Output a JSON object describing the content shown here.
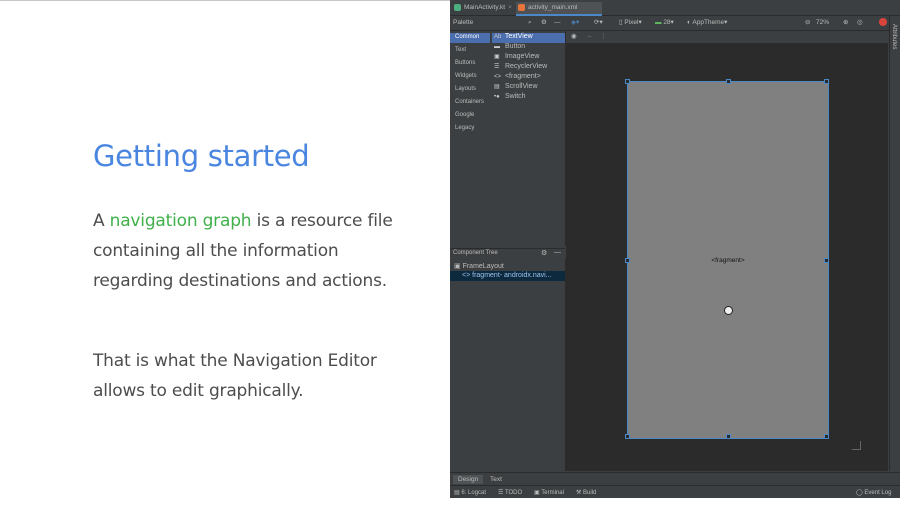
{
  "slide": {
    "title": "Getting started",
    "para1_prefix": "A ",
    "para1_highlight": "navigation graph",
    "para1_suffix": " is a resource file containing all the information regarding destinations and actions.",
    "para2": "That is what the Navigation Editor allows to edit graphically.",
    "colors": {
      "title": "#4a86e0",
      "highlight": "#3fb04a",
      "body": "#4d4d4d"
    }
  },
  "ide": {
    "tabs": [
      {
        "label": "MainActivity.kt"
      },
      {
        "label": "activity_main.xml"
      }
    ],
    "toolbar": {
      "palette_label": "Palette",
      "device": "Pixel",
      "api": "28",
      "theme": "AppTheme",
      "zoom": "72%"
    },
    "palette": {
      "categories": [
        "Common",
        "Text",
        "Buttons",
        "Widgets",
        "Layouts",
        "Containers",
        "Google",
        "Legacy"
      ],
      "items": [
        {
          "glyph": "Ab",
          "label": "TextView"
        },
        {
          "glyph": "▬",
          "label": "Button"
        },
        {
          "glyph": "▣",
          "label": "ImageView"
        },
        {
          "glyph": "☰",
          "label": "RecyclerView"
        },
        {
          "glyph": "<>",
          "label": "<fragment>"
        },
        {
          "glyph": "▤",
          "label": "ScrollView"
        },
        {
          "glyph": "•●",
          "label": "Switch"
        }
      ]
    },
    "component_tree": {
      "header": "Component Tree",
      "root": "FrameLayout",
      "child": "fragment- androidx.navi..."
    },
    "canvas": {
      "fragment_label": "<fragment>"
    },
    "right_strip": "Attributes",
    "modes": [
      "Design",
      "Text"
    ],
    "status": {
      "logcat": "6: Logcat",
      "todo": "TODO",
      "terminal": "Terminal",
      "build": "Build",
      "event_log": "Event Log"
    }
  }
}
